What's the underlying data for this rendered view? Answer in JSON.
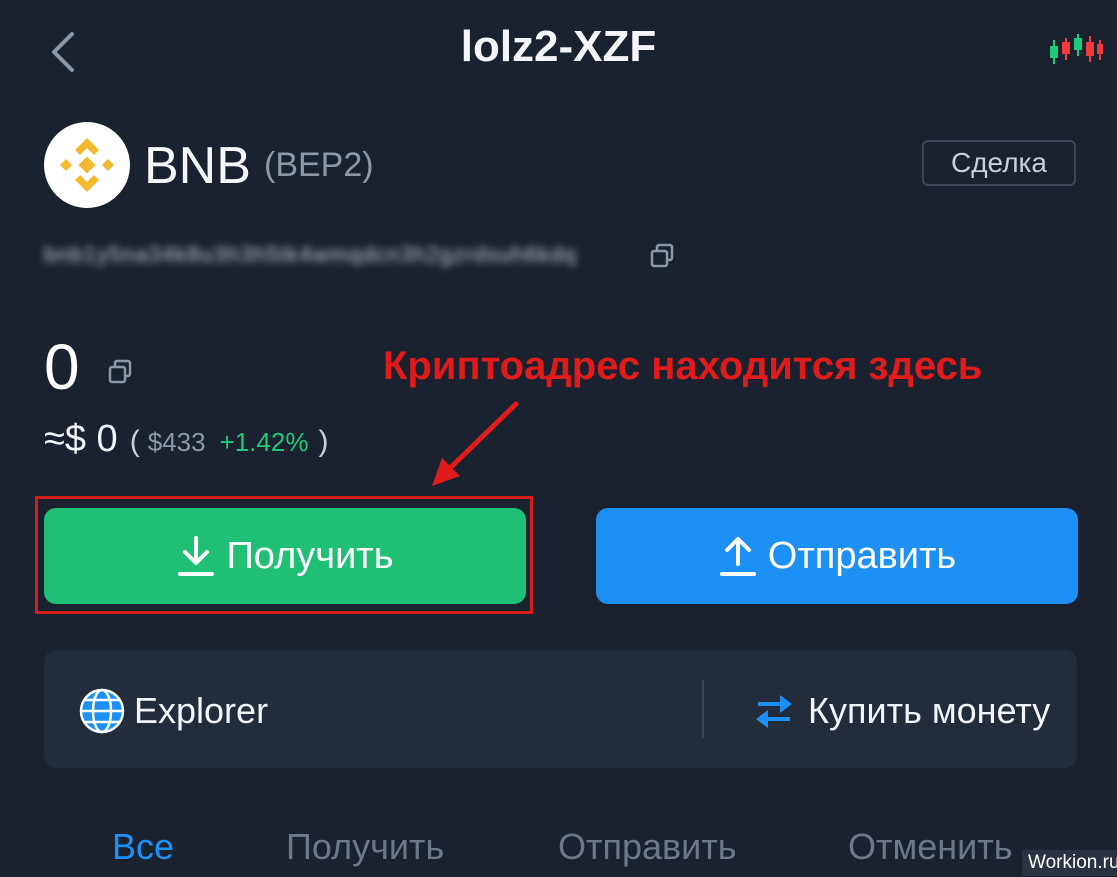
{
  "header": {
    "title": "lolz2-XZF",
    "back_icon": "chevron-left-icon",
    "chart_icon": "candlestick-chart-icon"
  },
  "coin": {
    "name": "BNB",
    "network": "(BEP2)",
    "trade_label": "Сделка",
    "address": "bnb1y5na34k8u3h3h5tk4wmqdcn3h2gzrdsuh6kdq"
  },
  "balance": {
    "amount": "0",
    "fiat": "≈$ 0",
    "paren_open": "(",
    "price": "$433",
    "change": "+1.42%",
    "paren_close": ")"
  },
  "annotation": {
    "text": "Криптоадрес находится здесь",
    "color": "#e11b1b"
  },
  "actions": {
    "receive_label": "Получить",
    "send_label": "Отправить",
    "receive_color": "#1fc075",
    "send_color": "#1d90f5"
  },
  "links": {
    "explorer_label": "Explorer",
    "buy_label": "Купить монету"
  },
  "tabs": [
    {
      "label": "Все",
      "active": true
    },
    {
      "label": "Получить",
      "active": false
    },
    {
      "label": "Отправить",
      "active": false
    },
    {
      "label": "Отменить",
      "active": false
    }
  ],
  "watermark": "Workion.ru"
}
